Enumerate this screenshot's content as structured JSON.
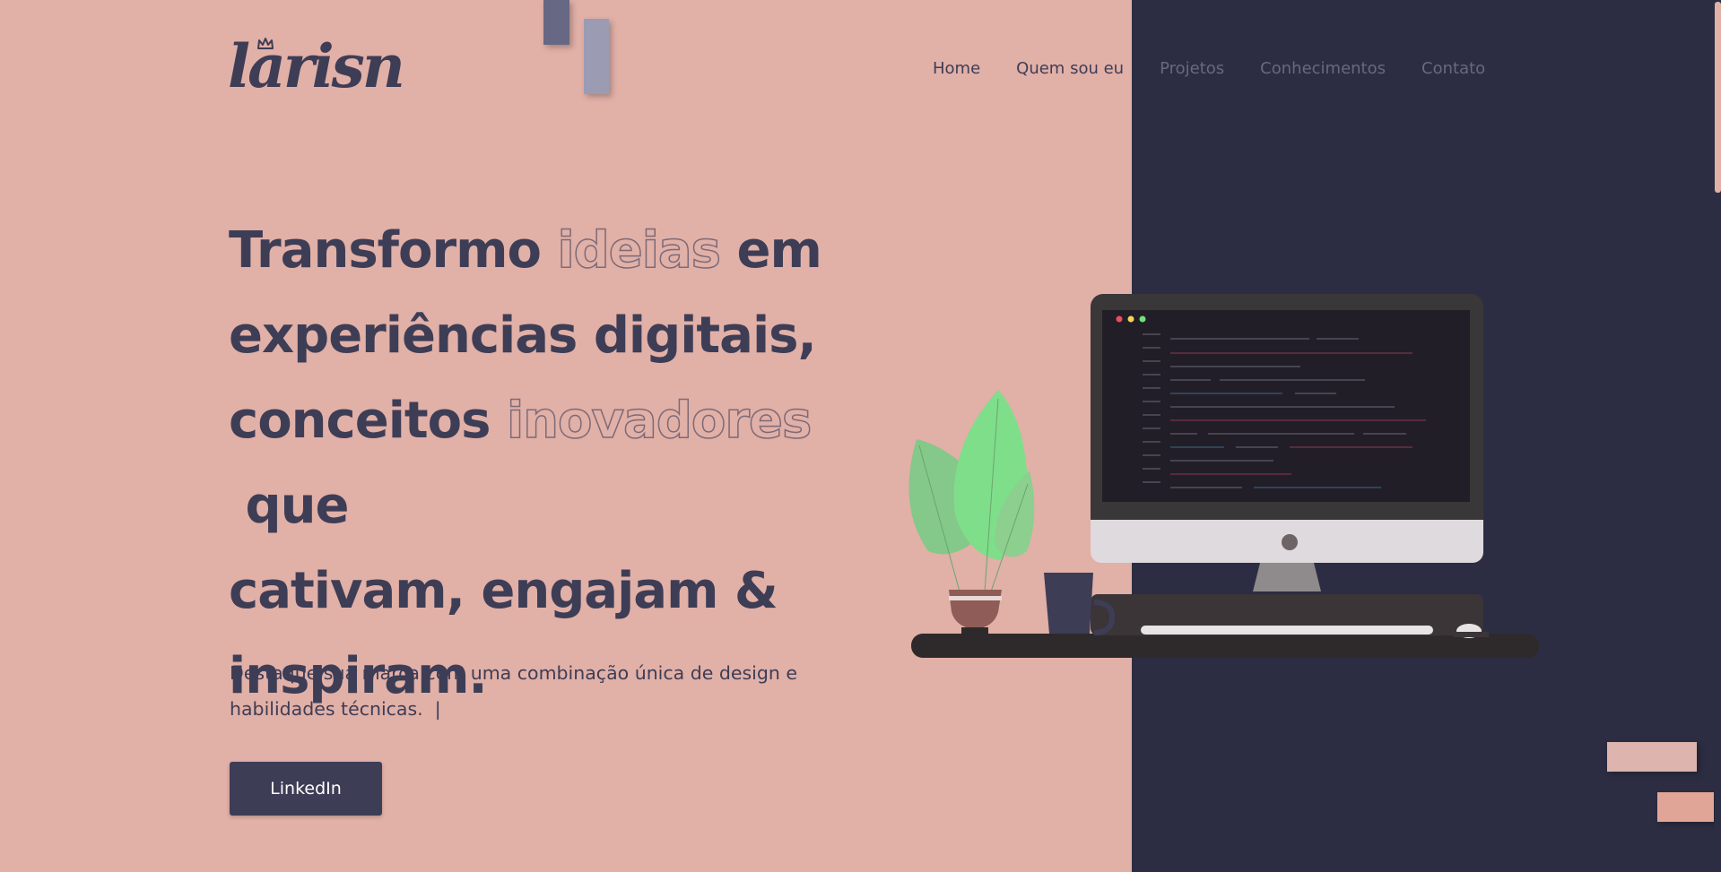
{
  "logo": {
    "text": "larisn"
  },
  "nav": {
    "items": [
      {
        "label": "Home"
      },
      {
        "label": "Quem sou eu"
      },
      {
        "label": "Projetos"
      },
      {
        "label": "Conhecimentos"
      },
      {
        "label": "Contato"
      }
    ]
  },
  "hero": {
    "line1": {
      "a": "Transformo ",
      "outline": "ideias",
      "b": " em"
    },
    "line2": "experiências digitais,",
    "line3": {
      "a": "conceitos ",
      "outline": "inovadores",
      "b": " que"
    },
    "line4": "cativam, engajam &",
    "line5": "inspiram.",
    "subtitle_line1": "Destaque sua marca com uma combinação única de design e",
    "subtitle_line2": "habilidades técnicas.",
    "cursor": "|",
    "button_label": "LinkedIn"
  },
  "colors": {
    "pink": "#e1b0a7",
    "navy": "#2c2d42",
    "text": "#3e3d56",
    "leaf": "#7fde8a"
  }
}
